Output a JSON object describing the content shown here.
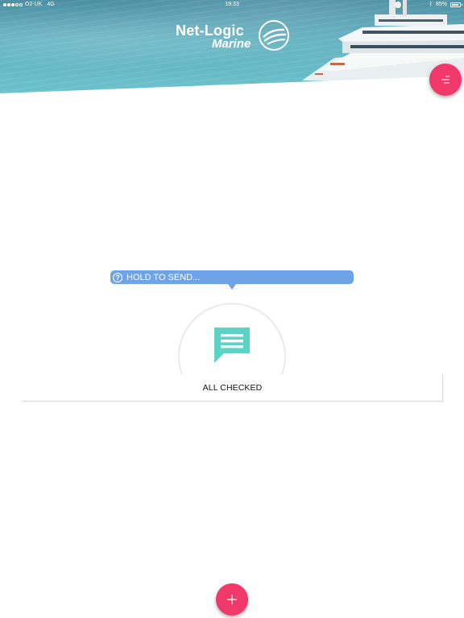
{
  "status_bar": {
    "carrier": "O2-UK",
    "network": "4G",
    "time": "19:33",
    "battery": "85%"
  },
  "header": {
    "logo_line1": "Net-Logic",
    "logo_line2": "Marine"
  },
  "main": {
    "tooltip_text": "HOLD TO SEND...",
    "tooltip_icon": "?",
    "card_label": "ALL CHECKED"
  },
  "colors": {
    "accent": "#f0386b",
    "tooltip": "#6ea3e8",
    "chat_icon": "#5bd4c6"
  },
  "icons": {
    "menu": "menu-lines-icon",
    "add": "plus-icon",
    "message": "chat-bubble-icon",
    "help": "question-circle-icon"
  }
}
